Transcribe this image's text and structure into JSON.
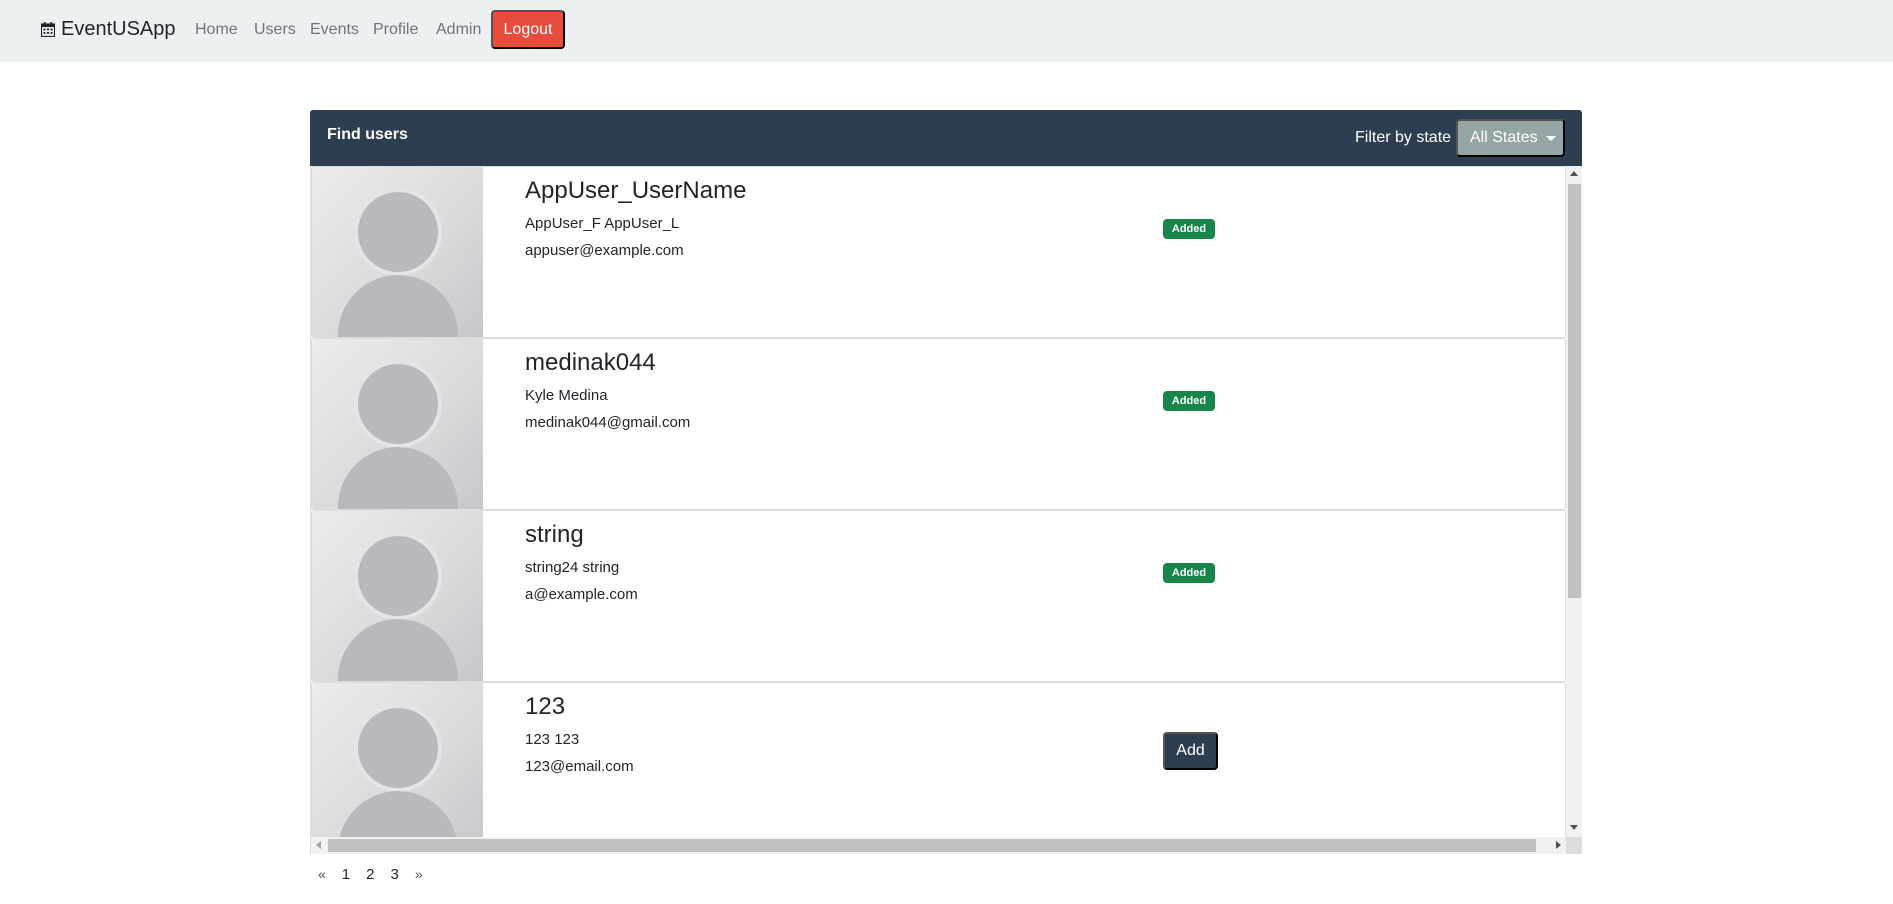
{
  "navbar": {
    "brand": "EventUSApp",
    "links": [
      "Home",
      "Users",
      "Events",
      "Profile",
      "Admin"
    ],
    "logout": "Logout"
  },
  "card": {
    "title": "Find users",
    "filter_label": "Filter by state",
    "filter_value": "All States"
  },
  "users": [
    {
      "username": "AppUser_UserName",
      "fullname": "AppUser_F AppUser_L",
      "email": "appuser@example.com",
      "status": "Added"
    },
    {
      "username": "medinak044",
      "fullname": "Kyle Medina",
      "email": "medinak044@gmail.com",
      "status": "Added"
    },
    {
      "username": "string",
      "fullname": "string24 string",
      "email": "a@example.com",
      "status": "Added"
    },
    {
      "username": "123",
      "fullname": "123 123",
      "email": "123@email.com",
      "action": "Add"
    }
  ],
  "pagination": {
    "prev": "«",
    "pages": [
      "1",
      "2",
      "3"
    ],
    "next": "»"
  },
  "colors": {
    "navbar_bg": "#ecf0f1",
    "header_bg": "#2c3e50",
    "logout": "#e74c3c",
    "badge_added": "#18864b",
    "filter_button": "#95a5a6"
  },
  "icons": {
    "brand_icon": "calendar-icon",
    "avatar": "user-placeholder-icon"
  }
}
